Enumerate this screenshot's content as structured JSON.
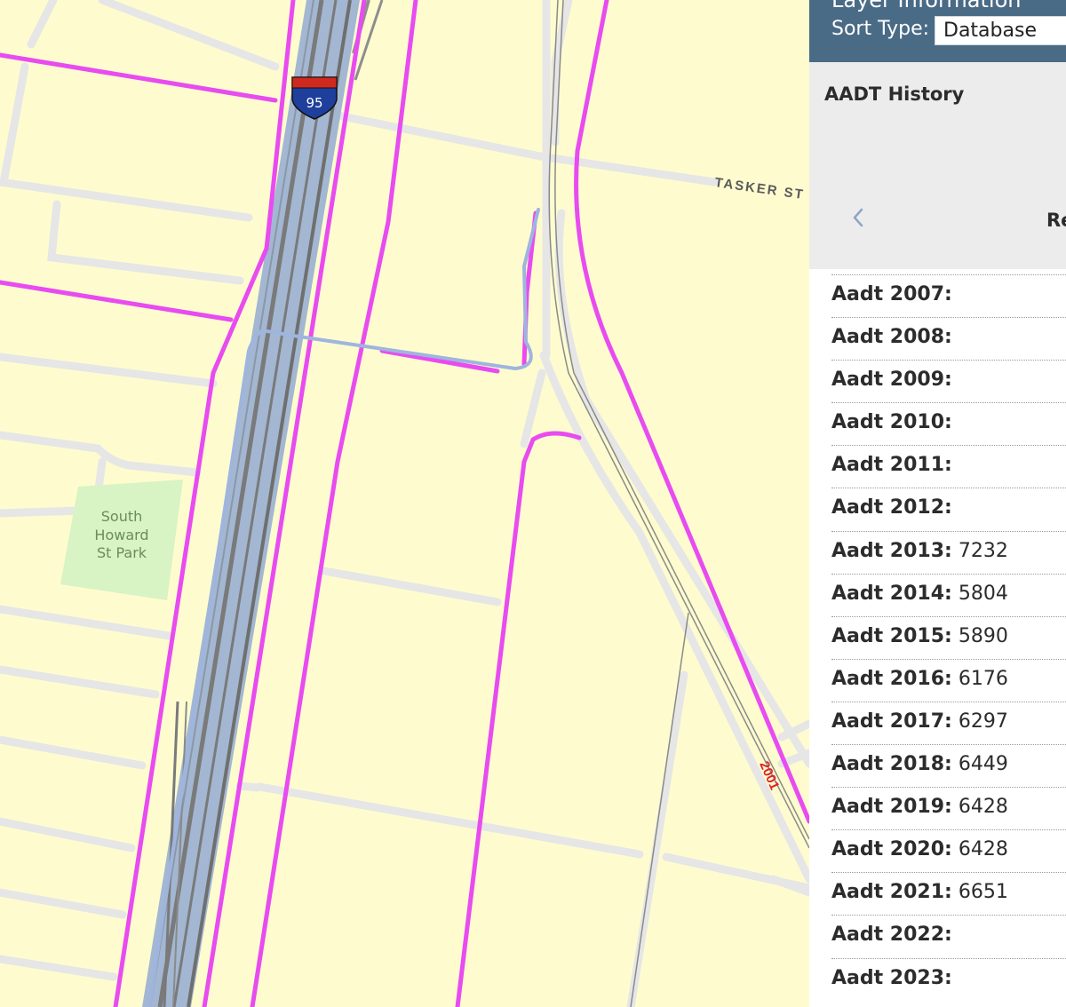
{
  "panel": {
    "header_title": "Layer Information",
    "sort_label": "Sort Type:",
    "sort_value": "Database",
    "history_title": "AADT History",
    "history_right_text": "Re",
    "rows": [
      {
        "label": "Aadt 2007:",
        "value": ""
      },
      {
        "label": "Aadt 2008:",
        "value": ""
      },
      {
        "label": "Aadt 2009:",
        "value": ""
      },
      {
        "label": "Aadt 2010:",
        "value": ""
      },
      {
        "label": "Aadt 2011:",
        "value": ""
      },
      {
        "label": "Aadt 2012:",
        "value": ""
      },
      {
        "label": "Aadt 2013:",
        "value": "7232"
      },
      {
        "label": "Aadt 2014:",
        "value": "5804"
      },
      {
        "label": "Aadt 2015:",
        "value": "5890"
      },
      {
        "label": "Aadt 2016:",
        "value": "6176"
      },
      {
        "label": "Aadt 2017:",
        "value": "6297"
      },
      {
        "label": "Aadt 2018:",
        "value": "6449"
      },
      {
        "label": "Aadt 2019:",
        "value": "6428"
      },
      {
        "label": "Aadt 2020:",
        "value": "6428"
      },
      {
        "label": "Aadt 2021:",
        "value": "6651"
      },
      {
        "label": "Aadt 2022:",
        "value": ""
      },
      {
        "label": "Aadt 2023:",
        "value": ""
      }
    ]
  },
  "map": {
    "interstate_shield": "95",
    "street_label": "TASKER ST",
    "park_label_1": "South",
    "park_label_2": "Howard",
    "park_label_3": "St Park",
    "route_label": "2001"
  },
  "colors": {
    "map_background": "#fefccf",
    "road_minor": "#e6e6e6",
    "road_highlight": "#e84bf0",
    "highway": "#a3b7d2",
    "highway_median": "#7a7a7a",
    "park": "#d8f3c4",
    "panel_header": "#4a6b86",
    "route_label": "#e0202a"
  },
  "icons": {
    "shield": "interstate-shield-icon",
    "chevron": "chevron-left-icon"
  }
}
